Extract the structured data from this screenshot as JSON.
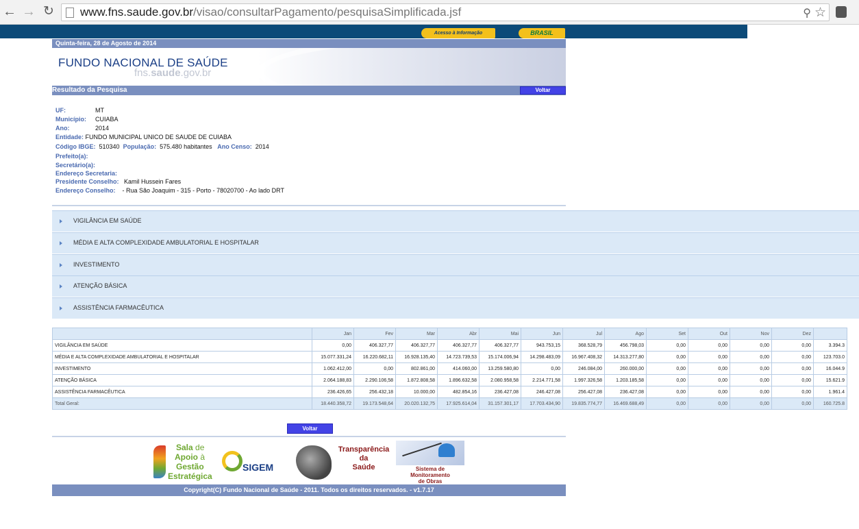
{
  "browser": {
    "url_host": "www.fns.saude.gov.br",
    "url_path": "/visao/consultarPagamento/pesquisaSimplificada.jsf"
  },
  "govbar": {
    "acesso_label": "Acesso à Informação",
    "brasil_label": "BRASIL"
  },
  "header": {
    "date": "Quinta-feira, 28 de Agosto de 2014",
    "title": "FUNDO NACIONAL DE SAÚDE",
    "subtitle_pre": "fns.",
    "subtitle_bold": "saude",
    "subtitle_post": ".gov.br",
    "result_title": "Resultado da Pesquisa",
    "voltar_label": "Voltar"
  },
  "info": {
    "uf_k": "UF:",
    "uf_v": "MT",
    "municipio_k": "Município:",
    "municipio_v": "CUIABA",
    "ano_k": "Ano:",
    "ano_v": "2014",
    "entidade_k": "Entidade:",
    "entidade_v": "FUNDO MUNICIPAL UNICO DE SAUDE DE CUIABA",
    "ibge_k": "Código IBGE:",
    "ibge_v": "510340",
    "pop_k": "População:",
    "pop_v": "575.480 habitantes",
    "censo_k": "Ano Censo:",
    "censo_v": "2014",
    "prefeito_k": "Prefeito(a):",
    "secretario_k": "Secretário(a):",
    "end_sec_k": "Endereço Secretaria:",
    "pres_k": "Presidente Conselho:",
    "pres_v": "Kamil Hussein Fares",
    "end_cons_k": "Endereço Conselho:",
    "end_cons_v": "- Rua São Joaquim - 315 - Porto - 78020700 - Ao lado DRT"
  },
  "accordion": [
    "VIGILÂNCIA EM SAÚDE",
    "MÉDIA E ALTA COMPLEXIDADE AMBULATORIAL E HOSPITALAR",
    "INVESTIMENTO",
    "ATENÇÃO BÁSICA",
    "ASSISTÊNCIA FARMACÊUTICA"
  ],
  "table": {
    "months": [
      "Jan",
      "Fev",
      "Mar",
      "Abr",
      "Mai",
      "Jun",
      "Jul",
      "Ago",
      "Set",
      "Out",
      "Nov",
      "Dez"
    ],
    "rows": [
      {
        "name": "VIGILÂNCIA EM SAÚDE",
        "values": [
          "0,00",
          "406.327,77",
          "406.327,77",
          "406.327,77",
          "406.327,77",
          "943.753,15",
          "368.528,79",
          "456.798,03",
          "0,00",
          "0,00",
          "0,00",
          "0,00",
          "3.394.3"
        ]
      },
      {
        "name": "MÉDIA E ALTA COMPLEXIDADE AMBULATORIAL E HOSPITALAR",
        "values": [
          "15.077.331,24",
          "16.220.682,11",
          "16.928.135,40",
          "14.723.739,53",
          "15.174.006,94",
          "14.298.483,09",
          "16.967.408,32",
          "14.313.277,80",
          "0,00",
          "0,00",
          "0,00",
          "0,00",
          "123.703.0"
        ]
      },
      {
        "name": "INVESTIMENTO",
        "values": [
          "1.062.412,00",
          "0,00",
          "802.861,00",
          "414.060,00",
          "13.259.580,80",
          "0,00",
          "246.084,00",
          "260.000,00",
          "0,00",
          "0,00",
          "0,00",
          "0,00",
          "16.044.9"
        ]
      },
      {
        "name": "ATENÇÃO BÁSICA",
        "values": [
          "2.064.188,83",
          "2.290.106,58",
          "1.872.808,58",
          "1.896.632,58",
          "2.080.958,58",
          "2.214.771,58",
          "1.997.326,58",
          "1.203.185,58",
          "0,00",
          "0,00",
          "0,00",
          "0,00",
          "15.621.9"
        ]
      },
      {
        "name": "ASSISTÊNCIA FARMACÊUTICA",
        "values": [
          "236.426,65",
          "256.432,18",
          "10.000,00",
          "482.854,16",
          "236.427,08",
          "246.427,08",
          "256.427,08",
          "236.427,08",
          "0,00",
          "0,00",
          "0,00",
          "0,00",
          "1.961.4"
        ]
      }
    ],
    "total": {
      "name": "Total Geral:",
      "values": [
        "18.440.358,72",
        "19.173.548,64",
        "20.020.132,75",
        "17.925.614,04",
        "31.157.301,17",
        "17.703.434,90",
        "19.835.774,77",
        "16.469.688,49",
        "0,00",
        "0,00",
        "0,00",
        "0,00",
        "160.725.8"
      ]
    }
  },
  "footer": {
    "voltar_label": "Voltar",
    "sala_line1": "Sala",
    "sala_line1b": "de",
    "sala_line2": "Apoio",
    "sala_line2b": "à",
    "sala_line3": "Gestão",
    "sala_line4": "Estratégica",
    "sigem": "SIGEM",
    "transp_line1": "Transparência",
    "transp_line2": "da",
    "transp_line3": "Saúde",
    "smo_line1": "Sistema de",
    "smo_line2": "Monitoramento",
    "smo_line3": "de Obras",
    "copyright": "Copyright(C) Fundo Nacional de Saúde - 2011. Todos os direitos reservados. - v1.7.17",
    "colors": {
      "sala_green": "#6fa832",
      "transp_red": "#8b1a1a",
      "sigem_blue": "#1b3f86"
    }
  }
}
